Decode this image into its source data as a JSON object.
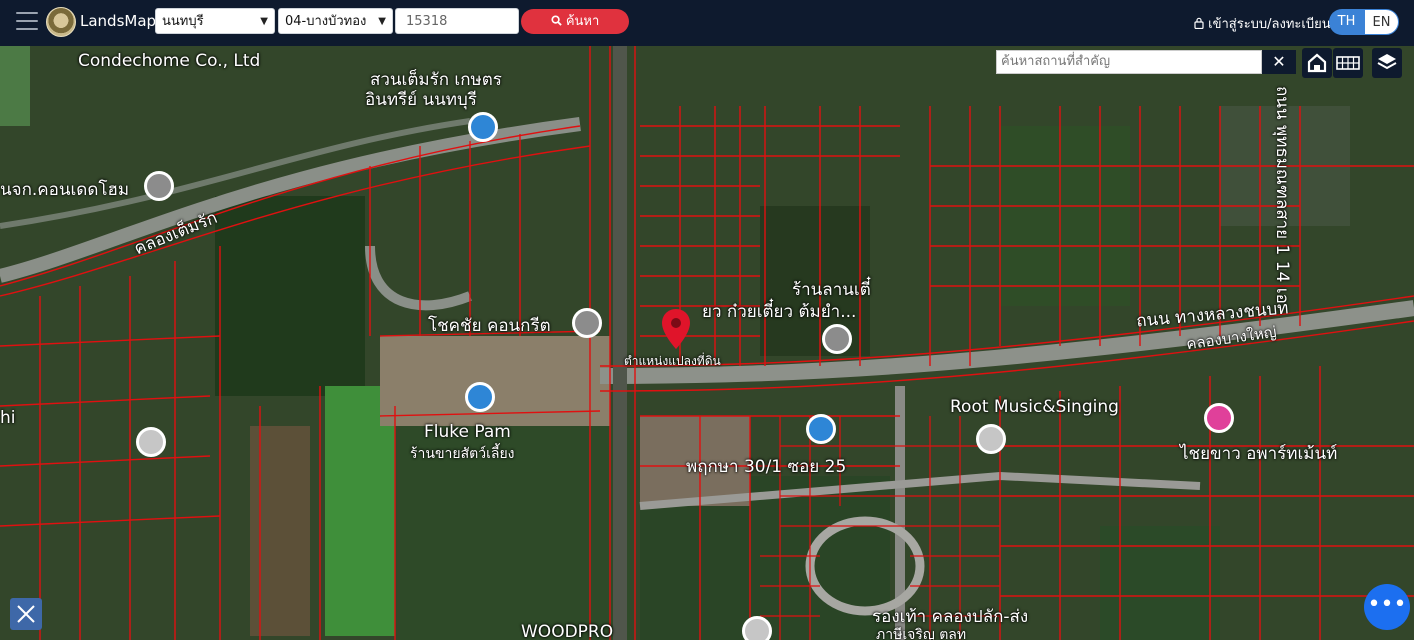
{
  "header": {
    "brand": "LandsMaps",
    "province_value": "นนทบุรี",
    "district_value": "04-บางบัวทอง",
    "parcel_value": "15318",
    "search_label": "ค้นหา",
    "login_label": "เข้าสู่ระบบ/ลงทะเบียน",
    "lang_th": "TH",
    "lang_en": "EN"
  },
  "map_tools": {
    "place_search_placeholder": "ค้นหาสถานที่สำคัญ",
    "clear_label": "✕"
  },
  "labels": {
    "condechome": "Condechome Co., Ltd",
    "suan": "สวนเต็มรัก เกษตร",
    "suan2": "อินทรีย์ นนทบุรี",
    "condo": "นจก.คอนเดดโฮม",
    "canal_temrak": "คลองเต็มรัก",
    "chokchai": "โชคชัย คอนกรีต",
    "parcel_pin": "ตำแหน่งแปลงที่ดิน",
    "noodle1": "ร้านลานเตี๋",
    "noodle2": "ยว ก๋วยเตี๋ยว ต้มยำ...",
    "road_14": "ถนน พุทธมณฑลสาย 1 14 เอ",
    "road_lhn": "ถนน ทางหลวงชนบท",
    "canal_bangyai": "คลองบางใหญ่",
    "root_music": "Root Music&Singing",
    "chaikhao": "ไชยขาว อพาร์ทเม้นท์",
    "fluke": "Fluke Pam",
    "pet_shop": "ร้านขายสัตว์เลี้ยง",
    "soi25": "พฤกษา 30/1 ซอย 25",
    "woodpro": "WOODPRO",
    "shi": "hi",
    "rong": "รองเท้า คลองปลัก-ส่ง",
    "rong2": "ภาษีเจริญ ตลท"
  },
  "colors": {
    "topbar": "#0e1a2e",
    "search_btn": "#e0323e",
    "lang_active": "#3b82d6",
    "parcel_line": "#e01010",
    "pin": "#e0142a"
  }
}
